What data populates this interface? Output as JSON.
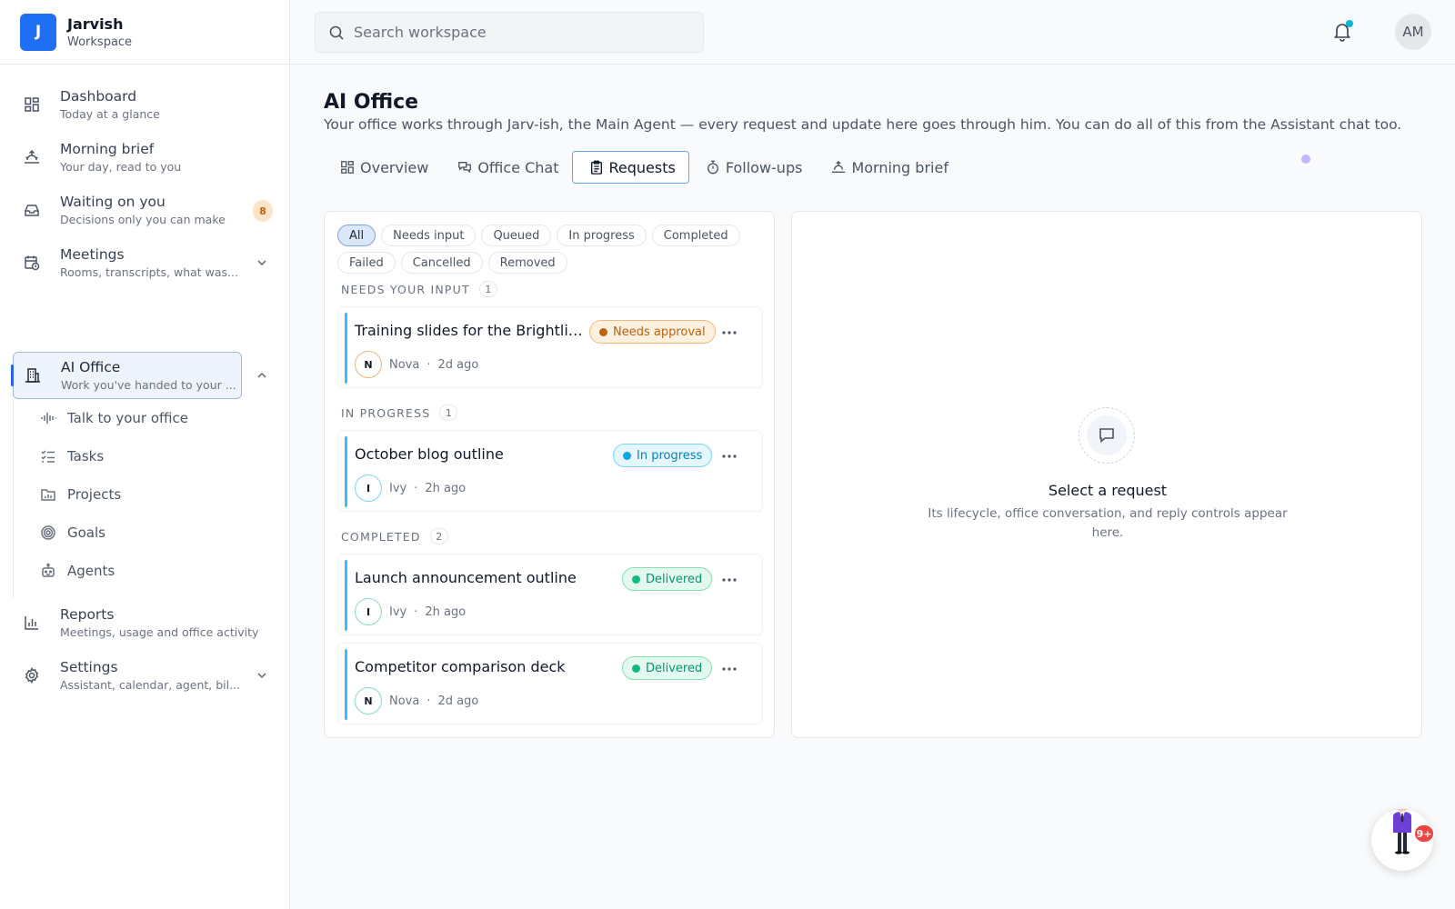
{
  "brand": {
    "initial": "J",
    "name": "Jarvish",
    "sub": "Workspace"
  },
  "sidebar": {
    "items": [
      {
        "label": "Dashboard",
        "sub": "Today at a glance",
        "icon": "grid-icon"
      },
      {
        "label": "Morning brief",
        "sub": "Your day, read to you",
        "icon": "sunrise-icon"
      },
      {
        "label": "Waiting on you",
        "sub": "Decisions only you can make",
        "icon": "inbox-icon",
        "badge": "8"
      },
      {
        "label": "Meetings",
        "sub": "Rooms, transcripts, what was...",
        "icon": "calendar-clock-icon"
      },
      {
        "label": "AI Office",
        "sub": "Work you've handed to your ...",
        "icon": "building-icon"
      },
      {
        "label": "Reports",
        "sub": "Meetings, usage and office activity",
        "icon": "bar-chart-icon"
      },
      {
        "label": "Settings",
        "sub": "Assistant, calendar, agent, bil...",
        "icon": "gear-icon"
      }
    ],
    "sub_items": [
      {
        "label": "Talk to your office",
        "icon": "audio-wave-icon"
      },
      {
        "label": "Tasks",
        "icon": "checklist-icon"
      },
      {
        "label": "Projects",
        "icon": "folder-chart-icon"
      },
      {
        "label": "Goals",
        "icon": "target-icon"
      },
      {
        "label": "Agents",
        "icon": "bot-icon"
      }
    ]
  },
  "header": {
    "search_placeholder": "Search workspace",
    "user_initials": "AM"
  },
  "page": {
    "title": "AI Office",
    "description": "Your office works through Jarv-ish, the Main Agent — every request and update here goes through him. You can do all of this from the Assistant chat too.",
    "tabs": [
      {
        "label": "Overview",
        "icon": "grid-icon"
      },
      {
        "label": "Office Chat",
        "icon": "chat-icon"
      },
      {
        "label": "Requests",
        "icon": "clipboard-icon",
        "active": true
      },
      {
        "label": "Follow-ups",
        "icon": "timer-icon"
      },
      {
        "label": "Morning brief",
        "icon": "sunrise-icon"
      }
    ]
  },
  "filters": [
    "All",
    "Needs input",
    "Queued",
    "In progress",
    "Completed",
    "Failed",
    "Cancelled",
    "Removed"
  ],
  "groups": [
    {
      "title": "NEEDS YOUR INPUT",
      "count": "1"
    },
    {
      "title": "IN PROGRESS",
      "count": "1"
    },
    {
      "title": "COMPLETED",
      "count": "2"
    }
  ],
  "requests": [
    {
      "title": "Training slides for the Brightline onboarding",
      "status": "Needs approval",
      "agent_initial": "N",
      "agent": "Nova",
      "time": "2d ago"
    },
    {
      "title": "October blog outline",
      "status": "In progress",
      "agent_initial": "I",
      "agent": "Ivy",
      "time": "2h ago"
    },
    {
      "title": "Launch announcement outline",
      "status": "Delivered",
      "agent_initial": "I",
      "agent": "Ivy",
      "time": "2h ago"
    },
    {
      "title": "Competitor comparison deck",
      "status": "Delivered",
      "agent_initial": "N",
      "agent": "Nova",
      "time": "2d ago"
    }
  ],
  "detail": {
    "empty_title": "Select a request",
    "empty_desc": "Its lifecycle, office conversation, and reply controls appear here."
  },
  "assistant": {
    "badge": "9+"
  },
  "colors": {
    "accent": "#1f6ff2",
    "approval": "#c2610c",
    "progress": "#0ea5e9",
    "delivered": "#10b981"
  }
}
